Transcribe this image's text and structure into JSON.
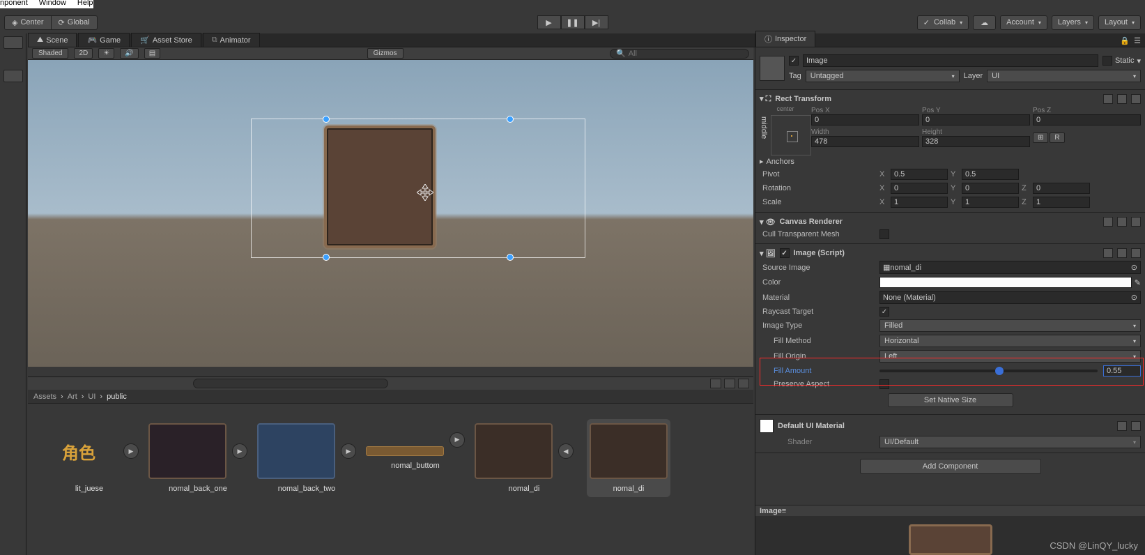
{
  "topmenu": [
    "nponent",
    "Window",
    "Help"
  ],
  "toolbar": {
    "left": [
      "Center",
      "Global"
    ],
    "right": [
      "Collab",
      "Account",
      "Layers",
      "Layout"
    ]
  },
  "tabs": [
    "Scene",
    "Game",
    "Asset Store",
    "Animator"
  ],
  "sceneToolbar": {
    "shaded": "Shaded",
    "mode": "2D",
    "gizmos": "Gizmos",
    "searchPrefix": "All"
  },
  "inspector": {
    "title": "Inspector",
    "object": {
      "enabled": true,
      "name": "Image",
      "static": "Static"
    },
    "tag": {
      "label": "Tag",
      "value": "Untagged"
    },
    "layer": {
      "label": "Layer",
      "value": "UI"
    },
    "rectTransform": {
      "title": "Rect Transform",
      "presetH": "center",
      "presetV": "middle",
      "posX": "0",
      "posY": "0",
      "posZ": "0",
      "width": "478",
      "height": "328",
      "anchors": "Anchors",
      "pivot": {
        "x": "0.5",
        "y": "0.5"
      },
      "rotation": {
        "x": "0",
        "y": "0",
        "z": "0"
      },
      "scale": {
        "x": "1",
        "y": "1",
        "z": "1"
      },
      "lbl": {
        "posx": "Pos X",
        "posy": "Pos Y",
        "posz": "Pos Z",
        "w": "Width",
        "h": "Height",
        "pivot": "Pivot",
        "rot": "Rotation",
        "scale": "Scale"
      }
    },
    "canvasRenderer": {
      "title": "Canvas Renderer",
      "cull": "Cull Transparent Mesh"
    },
    "image": {
      "title": "Image (Script)",
      "sourceImage": {
        "label": "Source Image",
        "value": "nomal_di"
      },
      "color": "Color",
      "material": {
        "label": "Material",
        "value": "None (Material)"
      },
      "raycast": "Raycast Target",
      "imageType": {
        "label": "Image Type",
        "value": "Filled"
      },
      "fillMethod": {
        "label": "Fill Method",
        "value": "Horizontal"
      },
      "fillOrigin": {
        "label": "Fill Origin",
        "value": "Left"
      },
      "fillAmount": {
        "label": "Fill Amount",
        "value": "0.55"
      },
      "preserveAspect": "Preserve Aspect",
      "setNative": "Set Native Size"
    },
    "material": {
      "title": "Default UI Material",
      "shader": {
        "label": "Shader",
        "value": "UI/Default"
      }
    },
    "addComponent": "Add Component",
    "previewTitle": "Image"
  },
  "project": {
    "breadcrumb": [
      "Assets",
      "Art",
      "UI",
      "public"
    ],
    "assets": [
      {
        "label": "lit_juese",
        "kind": "text",
        "glyph": "角色"
      },
      {
        "label": "nomal_back_one",
        "kind": "dark"
      },
      {
        "label": "nomal_back_two",
        "kind": "blue"
      },
      {
        "label": "nomal_buttom",
        "kind": "bar"
      },
      {
        "label": "nomal_di",
        "kind": "frame"
      },
      {
        "label": "nomal_di",
        "kind": "frame",
        "selected": true
      }
    ]
  },
  "watermark": "CSDN @LinQY_lucky"
}
